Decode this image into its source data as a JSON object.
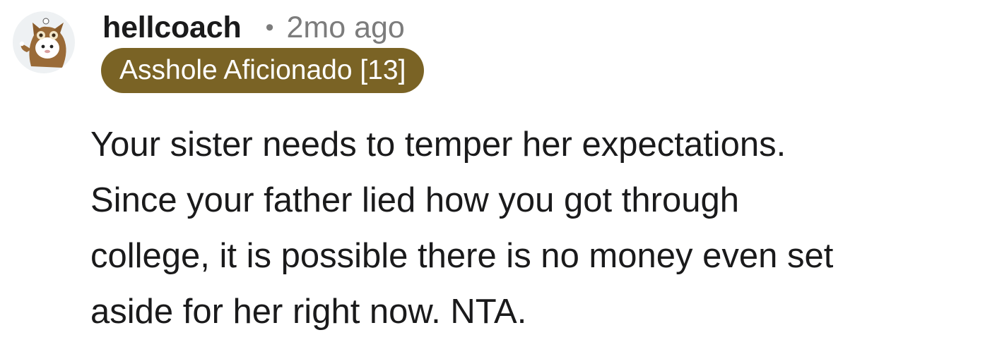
{
  "comment": {
    "author": "hellcoach",
    "separator": "•",
    "timestamp": "2mo ago",
    "flair": {
      "text": "Asshole Aficionado [13]",
      "background_color": "#7a6325",
      "text_color": "#ffffff"
    },
    "body": "Your sister needs to temper her expectations.\nSince your father lied how you got through\ncollege, it is possible there is no money even set\naside for her right now. NTA.",
    "avatar": {
      "icon": "owl-costume-avatar-icon"
    }
  },
  "colors": {
    "text_primary": "#1a1a1b",
    "text_secondary": "#7c7c7c",
    "avatar_bg": "#eef1f3"
  }
}
